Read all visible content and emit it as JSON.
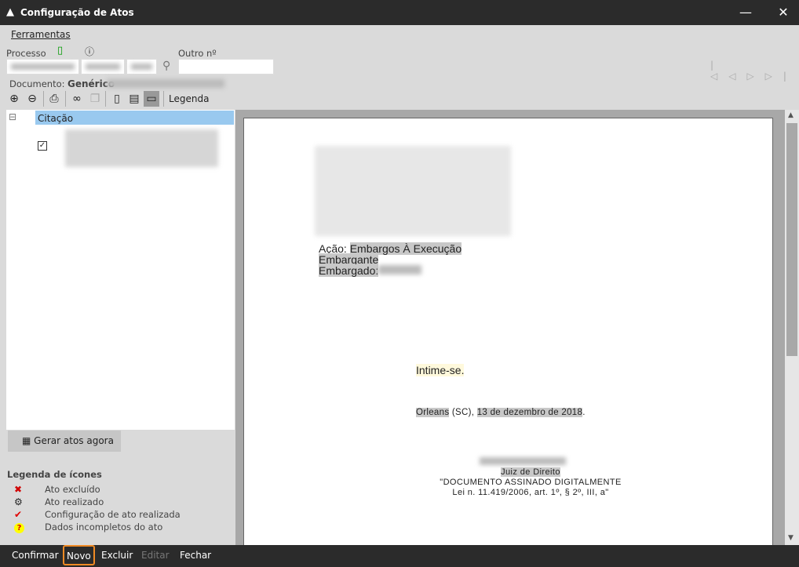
{
  "window": {
    "title": "Configuração de Atos",
    "minimize": "—",
    "close": "✕"
  },
  "menu": {
    "ferramentas": "Ferramentas"
  },
  "form": {
    "processo_label": "Processo",
    "outro_label": "Outro nº",
    "documento_label": "Documento:",
    "documento_value": "Genérico"
  },
  "toolbar": {
    "legenda": "Legenda"
  },
  "tree": {
    "root": "Citação",
    "expander": "⊟"
  },
  "gerar_button": "Gerar atos agora",
  "legend": {
    "title": "Legenda de ícones",
    "items": [
      {
        "icon": "x-icon",
        "label": "Ato excluído",
        "glyph": "✖",
        "color": "#d00000"
      },
      {
        "icon": "gear-icon",
        "label": "Ato realizado",
        "glyph": "⚙",
        "color": "#000000"
      },
      {
        "icon": "check-icon",
        "label": "Configuração de ato realizada",
        "glyph": "✔",
        "color": "#e00000"
      },
      {
        "icon": "question-icon",
        "label": "Dados incompletos do ato",
        "glyph": "?",
        "color": "#d00000"
      }
    ]
  },
  "document": {
    "acao_label": "Ação:",
    "acao_value": "Embargos À Execução",
    "embargante": "Embargante",
    "embargado": "Embargado:",
    "intime": "Intime-se.",
    "cidade": "Orleans",
    "uf": "(SC),",
    "data": "13 de dezembro de 2018",
    "ponto": ".",
    "cargo": "Juiz de Direito",
    "assinatura1": "\"DOCUMENTO ASSINADO DIGITALMENTE",
    "assinatura2": "Lei n. 11.419/2006, art. 1º, § 2º, III, a\""
  },
  "bottom": {
    "confirmar": "Confirmar",
    "novo": "Novo",
    "excluir": "Excluir",
    "editar": "Editar",
    "fechar": "Fechar"
  },
  "colors": {
    "highlight": "#f08a24",
    "selection": "#99c9ef",
    "titlebar": "#2b2b2b"
  }
}
